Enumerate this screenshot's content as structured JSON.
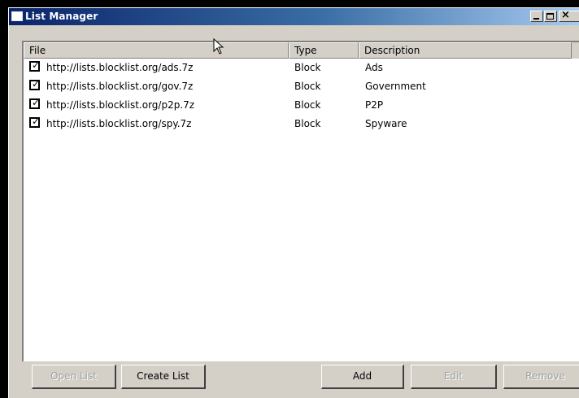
{
  "window": {
    "title": "List Manager",
    "controls": {
      "minimize": "_",
      "maximize": "□",
      "close": "×"
    }
  },
  "list": {
    "columns": [
      "File",
      "Type",
      "Description"
    ],
    "rows": [
      {
        "checked": true,
        "file": "http://lists.blocklist.org/ads.7z",
        "type": "Block",
        "description": "Ads"
      },
      {
        "checked": true,
        "file": "http://lists.blocklist.org/gov.7z",
        "type": "Block",
        "description": "Government"
      },
      {
        "checked": true,
        "file": "http://lists.blocklist.org/p2p.7z",
        "type": "Block",
        "description": "P2P"
      },
      {
        "checked": true,
        "file": "http://lists.blocklist.org/spy.7z",
        "type": "Block",
        "description": "Spyware"
      }
    ]
  },
  "buttons": {
    "open_list": "Open List",
    "create_list": "Create List",
    "add": "Add",
    "edit": "Edit",
    "remove": "Remove"
  },
  "colors": {
    "titlebar_start": "#0a246a",
    "titlebar_end": "#a6caf0",
    "face": "#d4d0c8"
  }
}
